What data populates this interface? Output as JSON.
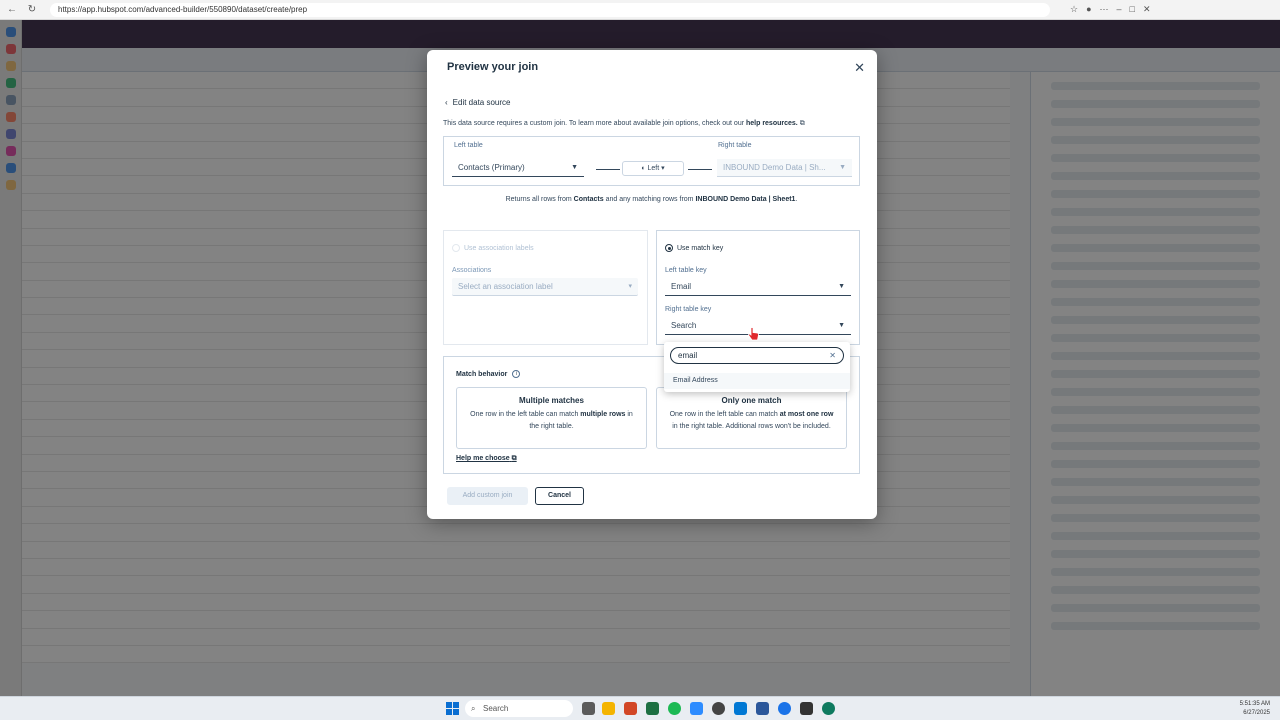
{
  "browser": {
    "url": "https://app.hubspot.com/advanced-builder/550890/dataset/create/prep"
  },
  "taskbar": {
    "search_placeholder": "Search",
    "time": "5:51:35 AM",
    "date": "6/27/2025"
  },
  "modal": {
    "title": "Preview your join",
    "close_icon": "close-icon",
    "back_label": "Edit data source",
    "info_prefix": "This data source requires a custom join. To learn more about available join options, check out our ",
    "info_link": "help resources.",
    "left_table_label": "Left table",
    "left_table_value": "Contacts (Primary)",
    "join_type": "Left",
    "right_table_label": "Right table",
    "right_table_value": "INBOUND Demo Data | Sh...",
    "return_prefix": "Returns all rows from ",
    "return_left": "Contacts",
    "return_mid": " and any matching rows from ",
    "return_right": "INBOUND Demo Data | Sheet1",
    "return_suffix": ".",
    "assoc_option": "Use association labels",
    "assoc_label": "Associations",
    "assoc_placeholder": "Select an association label",
    "match_key_option": "Use match key",
    "left_key_label": "Left table key",
    "left_key_value": "Email",
    "right_key_label": "Right table key",
    "right_key_value": "Search",
    "match_behavior_label": "Match behavior",
    "card_multiple_title": "Multiple matches",
    "card_multiple_desc_1": "One row in the left table can match ",
    "card_multiple_desc_bold": "multiple rows",
    "card_multiple_desc_2": " in the right table.",
    "card_one_title": "Only one match",
    "card_one_desc_1": "One row in the left table can match ",
    "card_one_desc_bold": "at most one row",
    "card_one_desc_2": " in the right table. Additional rows won't be included.",
    "help_choose": "Help me choose",
    "add_button": "Add custom join",
    "cancel_button": "Cancel"
  },
  "dropdown": {
    "search_value": "email",
    "option": "Email Address"
  }
}
